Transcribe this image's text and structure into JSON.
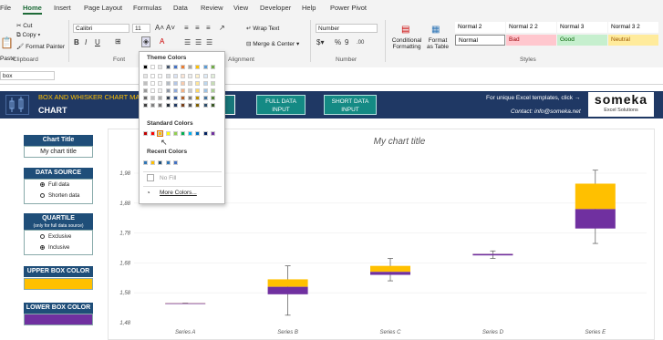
{
  "tabs": [
    "File",
    "Home",
    "Insert",
    "Page Layout",
    "Formulas",
    "Data",
    "Review",
    "View",
    "Developer",
    "Help",
    "Power Pivot"
  ],
  "active_tab": "Home",
  "clipboard": {
    "cut": "Cut",
    "copy": "Copy",
    "format_painter": "Format Painter",
    "paste": "Paste",
    "label": "Clipboard"
  },
  "font": {
    "name": "Calibri",
    "size": "11",
    "label": "Font"
  },
  "alignment": {
    "wrap_text": "Wrap Text",
    "merge_center": "Merge & Center",
    "label": "Alignment"
  },
  "number": {
    "format": "Number",
    "label": "Number"
  },
  "styles": {
    "conditional": "Conditional Formatting",
    "format_table": "Format as Table",
    "label": "Styles",
    "cells": [
      {
        "name": "Normal 2",
        "bg": "#ffffff",
        "fg": "#000000"
      },
      {
        "name": "Normal 2 2",
        "bg": "#ffffff",
        "fg": "#000000"
      },
      {
        "name": "Normal 3",
        "bg": "#ffffff",
        "fg": "#000000"
      },
      {
        "name": "Normal 3 2",
        "bg": "#ffffff",
        "fg": "#000000"
      },
      {
        "name": "Normal",
        "bg": "#ffffff",
        "fg": "#000000"
      },
      {
        "name": "Bad",
        "bg": "#ffc7ce",
        "fg": "#9c0006"
      },
      {
        "name": "Good",
        "bg": "#c6efce",
        "fg": "#006100"
      },
      {
        "name": "Neutral",
        "bg": "#ffeb9c",
        "fg": "#9c5700"
      }
    ]
  },
  "namebox": "box",
  "colors_popup": {
    "theme_title": "Theme Colors",
    "standard_title": "Standard Colors",
    "recent_title": "Recent Colors",
    "no_fill": "No Fill",
    "more_colors": "More Colors...",
    "theme_top": [
      "#000000",
      "#ffffff",
      "#e7e6e6",
      "#44546a",
      "#4472c4",
      "#ed7d31",
      "#a5a5a5",
      "#ffc000",
      "#5b9bd5",
      "#70ad47"
    ],
    "standard": [
      "#c00000",
      "#ff0000",
      "#ffc000",
      "#ffff00",
      "#92d050",
      "#00b050",
      "#00b0f0",
      "#0070c0",
      "#002060",
      "#7030a0"
    ],
    "recent": [
      "#2e75b6",
      "#ffc000",
      "#1f4e79",
      "#2e75b6",
      "#4472c4"
    ]
  },
  "header": {
    "title": "BOX AND WHISKER CHART MA",
    "subtitle": "CHART",
    "btn_full": "FULL DATA INPUT",
    "btn_short": "SHORT DATA INPUT",
    "promo": "For unique Excel templates, click →",
    "contact": "Contact: info@someka.net",
    "logo": "someka",
    "logo_sub": "Excel Solutions"
  },
  "panel": {
    "chart_title_label": "Chart Title",
    "chart_title_value": "My chart title",
    "data_source_label": "DATA SOURCE",
    "ds_options": [
      "Full data",
      "Shorten data"
    ],
    "ds_selected": 0,
    "quartile_label": "QUARTILE",
    "quartile_note": "(only for full data source)",
    "q_options": [
      "Exclusive",
      "Inclusive"
    ],
    "q_selected": 1,
    "upper_label": "UPPER BOX COLOR",
    "upper_color": "#ffc000",
    "lower_label": "LOWER BOX COLOR",
    "lower_color": "#7030a0"
  },
  "chart_data": {
    "type": "box",
    "title": "My chart title",
    "categories": [
      "Series A",
      "Series B",
      "Series C",
      "Series D",
      "Series E"
    ],
    "ylim": [
      1.48,
      1.98
    ],
    "yticks": [
      "1,48",
      "1,58",
      "1,68",
      "1,78",
      "1,88",
      "1,98"
    ],
    "tick_values": [
      1.48,
      1.58,
      1.68,
      1.78,
      1.88,
      1.98
    ],
    "upper_color": "#ffc000",
    "lower_color": "#7030a0",
    "series": [
      {
        "name": "Series A",
        "min": 1.545,
        "q1": 1.545,
        "median": 1.545,
        "q3": 1.545,
        "max": 1.545
      },
      {
        "name": "Series B",
        "min": 1.505,
        "q1": 1.575,
        "median": 1.6,
        "q3": 1.625,
        "max": 1.67
      },
      {
        "name": "Series C",
        "min": 1.62,
        "q1": 1.64,
        "median": 1.65,
        "q3": 1.67,
        "max": 1.695
      },
      {
        "name": "Series D",
        "min": 1.695,
        "q1": 1.705,
        "median": 1.71,
        "q3": 1.71,
        "max": 1.72
      },
      {
        "name": "Series E",
        "min": 1.745,
        "q1": 1.795,
        "median": 1.86,
        "q3": 1.945,
        "max": 1.99
      }
    ]
  }
}
